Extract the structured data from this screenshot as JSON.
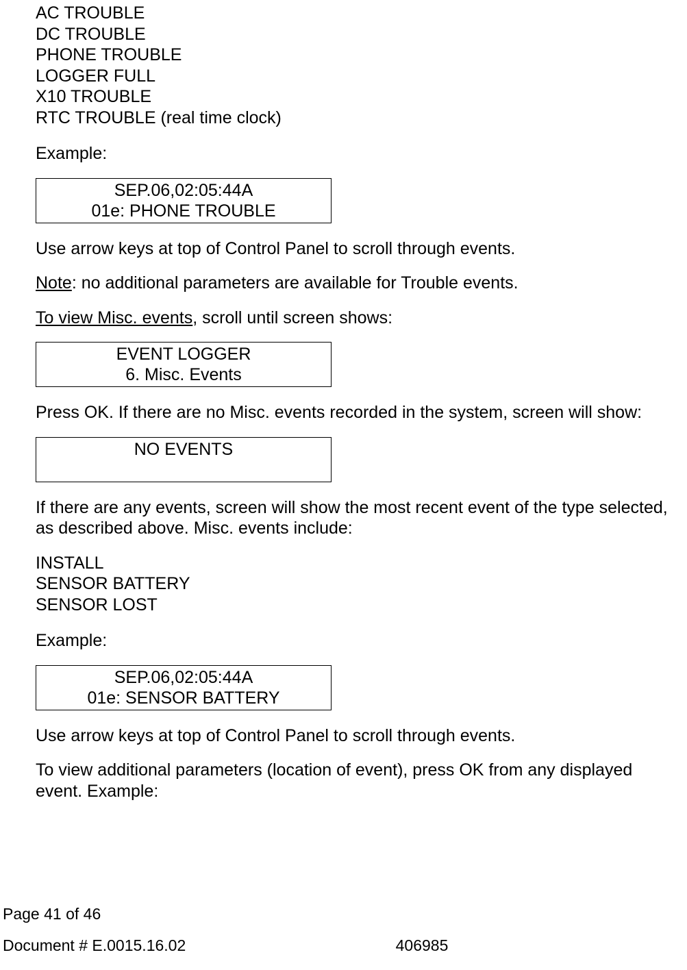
{
  "trouble_list": {
    "l0": "AC TROUBLE",
    "l1": "DC TROUBLE",
    "l2": "PHONE TROUBLE",
    "l3": "LOGGER FULL",
    "l4": "X10 TROUBLE",
    "l5": "RTC TROUBLE (real time clock)"
  },
  "example1_label": "Example:",
  "lcd1": {
    "line1": "SEP.06,02:05:44A",
    "line2": "01e: PHONE TROUBLE"
  },
  "para1": "Use arrow keys at top of Control Panel to scroll through events.",
  "note_label": "Note",
  "note_rest": ": no additional parameters are available for Trouble events.",
  "misc_label": "To view Misc. events",
  "misc_rest": ", scroll until screen shows:",
  "lcd2": {
    "line1": "EVENT LOGGER",
    "line2": "6. Misc. Events"
  },
  "para2": "Press OK. If there are no Misc. events recorded in the system, screen will show:",
  "lcd3": {
    "line1": "NO EVENTS",
    "line2": " "
  },
  "para3": "If there are any events, screen will show the most recent event of the type selected, as described above. Misc. events include:",
  "misc_list": {
    "l0": "INSTALL",
    "l1": "SENSOR BATTERY",
    "l2": "SENSOR LOST"
  },
  "example2_label": "Example:",
  "lcd4": {
    "line1": "SEP.06,02:05:44A",
    "line2": "01e: SENSOR BATTERY"
  },
  "para4": "Use arrow keys at top of Control Panel to scroll through events.",
  "para5": "To view additional parameters (location of event), press OK from any displayed event. Example:",
  "footer": {
    "page_label": "Page ",
    "page_cur": "41",
    "page_of": "  of   ",
    "page_total": "46",
    "doc_label": "Document # ",
    "doc_num": "E.0015.16.02",
    "right_num": "406985"
  }
}
